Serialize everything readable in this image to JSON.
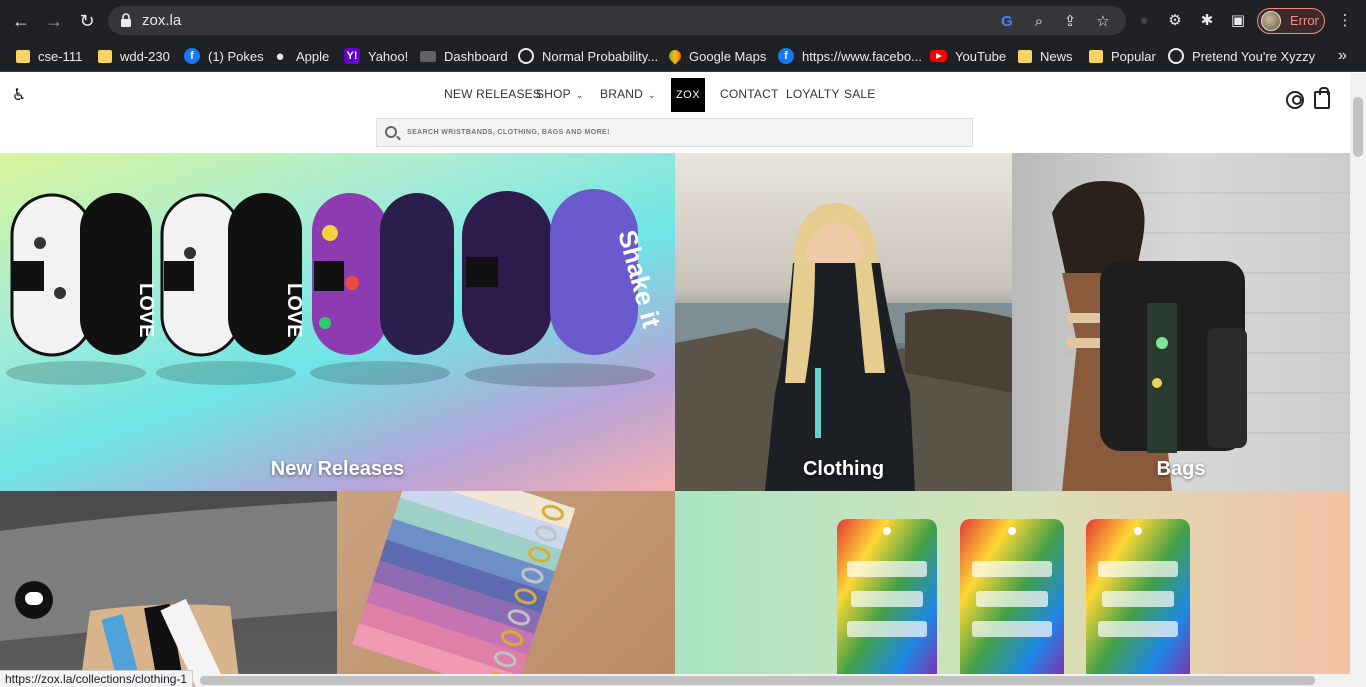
{
  "browser": {
    "url": "zox.la",
    "profile_label": "Error",
    "bookmarks": [
      {
        "label": "cse-111",
        "icon": "folder-icon"
      },
      {
        "label": "wdd-230",
        "icon": "folder-icon"
      },
      {
        "label": "(1) Pokes",
        "icon": "facebook-icon"
      },
      {
        "label": "Apple",
        "icon": "apple-icon"
      },
      {
        "label": "Yahoo!",
        "icon": "yahoo-icon"
      },
      {
        "label": "Dashboard",
        "icon": "dashboard-icon"
      },
      {
        "label": "Normal Probability...",
        "icon": "globe-icon"
      },
      {
        "label": "Google Maps",
        "icon": "maps-icon"
      },
      {
        "label": "https://www.facebo...",
        "icon": "facebook-icon"
      },
      {
        "label": "YouTube",
        "icon": "youtube-icon"
      },
      {
        "label": "News",
        "icon": "folder-icon"
      },
      {
        "label": "Popular",
        "icon": "folder-icon"
      },
      {
        "label": "Pretend You're Xyzzy",
        "icon": "globe-icon"
      }
    ],
    "more_bookmarks": "»",
    "status_url": "https://zox.la/collections/clothing-1"
  },
  "site": {
    "nav": {
      "new_releases": "NEW RELEASES",
      "shop": "SHOP",
      "brand": "BRAND",
      "logo": "ZOX",
      "contact": "CONTACT",
      "loyalty": "LOYALTY",
      "sale": "SALE"
    },
    "search": {
      "placeholder": "SEARCH WRISTBANDS, CLOTHING, BAGS AND MORE!"
    },
    "tiles": {
      "new_releases": "New Releases",
      "clothing": "Clothing",
      "bags": "Bags"
    }
  },
  "colors": {
    "chrome_bg": "#202124",
    "accent_error": "#f28b82",
    "logo_bg": "#000000"
  }
}
